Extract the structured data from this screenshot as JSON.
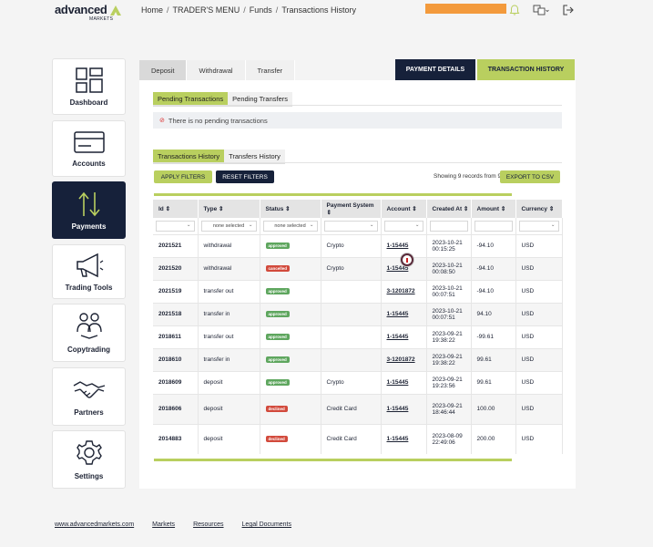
{
  "brand": {
    "name": "advanced",
    "sub": "MARKETS",
    "color": "#b9cf5f",
    "navy": "#16213a"
  },
  "breadcrumb": [
    "Home",
    "TRADER'S MENU",
    "Funds",
    "Transactions History"
  ],
  "header_icons": [
    "bell-icon",
    "translate-icon",
    "logout-icon"
  ],
  "sidebar": [
    {
      "label": "Dashboard",
      "icon": "dashboard-icon"
    },
    {
      "label": "Accounts",
      "icon": "card-icon"
    },
    {
      "label": "Payments",
      "icon": "transfer-arrows-icon"
    },
    {
      "label": "Trading Tools",
      "icon": "megaphone-icon"
    },
    {
      "label": "Copytrading",
      "icon": "people-icon"
    },
    {
      "label": "Partners",
      "icon": "handshake-icon"
    },
    {
      "label": "Settings",
      "icon": "gear-icon"
    }
  ],
  "subtabs": [
    "Deposit",
    "Withdrawal",
    "Transfer"
  ],
  "main_tabs": {
    "details": "PAYMENT DETAILS",
    "history": "TRANSACTION HISTORY"
  },
  "pending": {
    "tabs": [
      "Pending Transactions",
      "Pending Transfers"
    ],
    "notice": "There is no pending transactions"
  },
  "history": {
    "tabs": [
      "Transactions History",
      "Transfers History"
    ],
    "apply": "APPLY FILTERS",
    "reset": "RESET FILTERS",
    "records": "Showing 9 records from 9",
    "export": "EXPORT TO CSV"
  },
  "table": {
    "columns": [
      "Id ⇕",
      "Type ⇕",
      "Status ⇕",
      "Payment System ⇕",
      "Account ⇕",
      "Created At ⇕",
      "Amount ⇕",
      "Currency ⇕"
    ],
    "filters": {
      "type": "none selected",
      "status": "none selected"
    },
    "rows": [
      {
        "id": "2021521",
        "type": "withdrawal",
        "status": "approved",
        "system": "Crypto",
        "account": "1-15445",
        "date": "2023-10-21",
        "time": "00:15:25",
        "amount": "-94.10",
        "currency": "USD"
      },
      {
        "id": "2021520",
        "type": "withdrawal",
        "status": "cancelled",
        "system": "Crypto",
        "account": "1-15445",
        "date": "2023-10-21",
        "time": "00:08:50",
        "amount": "-94.10",
        "currency": "USD"
      },
      {
        "id": "2021519",
        "type": "transfer out",
        "status": "approved",
        "system": "",
        "account": "3-1201872",
        "date": "2023-10-21",
        "time": "00:07:51",
        "amount": "-94.10",
        "currency": "USD"
      },
      {
        "id": "2021518",
        "type": "transfer in",
        "status": "approved",
        "system": "",
        "account": "1-15445",
        "date": "2023-10-21",
        "time": "00:07:51",
        "amount": "94.10",
        "currency": "USD"
      },
      {
        "id": "2018611",
        "type": "transfer out",
        "status": "approved",
        "system": "",
        "account": "1-15445",
        "date": "2023-09-21",
        "time": "19:38:22",
        "amount": "-99.61",
        "currency": "USD"
      },
      {
        "id": "2018610",
        "type": "transfer in",
        "status": "approved",
        "system": "",
        "account": "3-1201872",
        "date": "2023-09-21",
        "time": "19:38:22",
        "amount": "99.61",
        "currency": "USD"
      },
      {
        "id": "2018609",
        "type": "deposit",
        "status": "approved",
        "system": "Crypto",
        "account": "1-15445",
        "date": "2023-09-21",
        "time": "19:23:56",
        "amount": "99.61",
        "currency": "USD"
      },
      {
        "id": "2018606",
        "type": "deposit",
        "status": "declined",
        "system": "Credit Card",
        "account": "1-15445",
        "date": "2023-09-21",
        "time": "18:46:44",
        "amount": "100.00",
        "currency": "USD"
      },
      {
        "id": "2014883",
        "type": "deposit",
        "status": "declined",
        "system": "Credit Card",
        "account": "1-15445",
        "date": "2023-08-09",
        "time": "22:49:06",
        "amount": "200.00",
        "currency": "USD"
      }
    ]
  },
  "footer": [
    "www.advancedmarkets.com",
    "Markets",
    "Resources",
    "Legal Documents"
  ]
}
